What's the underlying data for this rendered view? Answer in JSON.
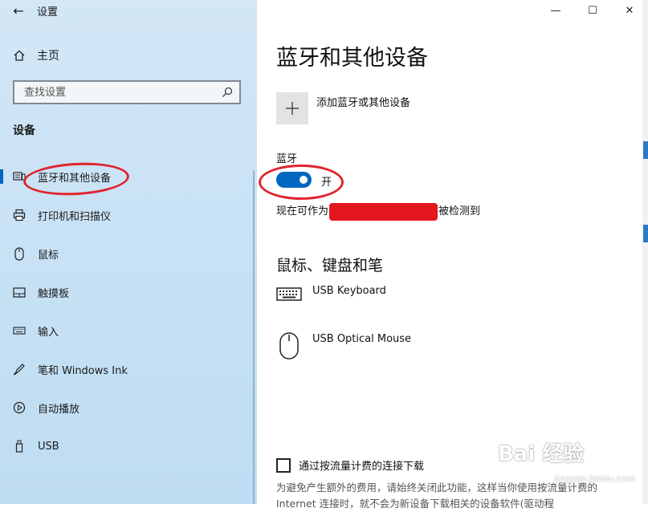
{
  "window": {
    "title": "设置"
  },
  "sidebar": {
    "home_label": "主页",
    "search_placeholder": "查找设置",
    "section_title": "设备",
    "items": [
      {
        "label": "蓝牙和其他设备",
        "icon": "bluetooth-devices-icon",
        "active": true
      },
      {
        "label": "打印机和扫描仪",
        "icon": "printer-icon"
      },
      {
        "label": "鼠标",
        "icon": "mouse-icon"
      },
      {
        "label": "触摸板",
        "icon": "touchpad-icon"
      },
      {
        "label": "输入",
        "icon": "keyboard-icon"
      },
      {
        "label": "笔和 Windows Ink",
        "icon": "pen-icon"
      },
      {
        "label": "自动播放",
        "icon": "autoplay-icon"
      },
      {
        "label": "USB",
        "icon": "usb-icon"
      }
    ]
  },
  "main": {
    "title": "蓝牙和其他设备",
    "add_label": "添加蓝牙或其他设备",
    "bluetooth_label": "蓝牙",
    "toggle_state": "开",
    "discover_prefix": "现在可作为",
    "discover_suffix": "被检测到",
    "section_title": "鼠标、键盘和笔",
    "devices": [
      {
        "name": "USB Keyboard",
        "icon": "keyboard-device-icon"
      },
      {
        "name": "USB Optical Mouse",
        "icon": "mouse-device-icon"
      }
    ],
    "metered_label": "通过按流量计费的连接下载",
    "metered_desc": "为避免产生额外的费用，请始终关闭此功能，这样当你使用按流量计费的 Internet 连接时，就不会为新设备下载相关的设备软件(驱动程"
  },
  "watermark": {
    "text": "Bai 经验",
    "sub": "jingyan.baidu.com"
  },
  "colors": {
    "accent": "#0067c0",
    "annotation": "#e0242e"
  }
}
